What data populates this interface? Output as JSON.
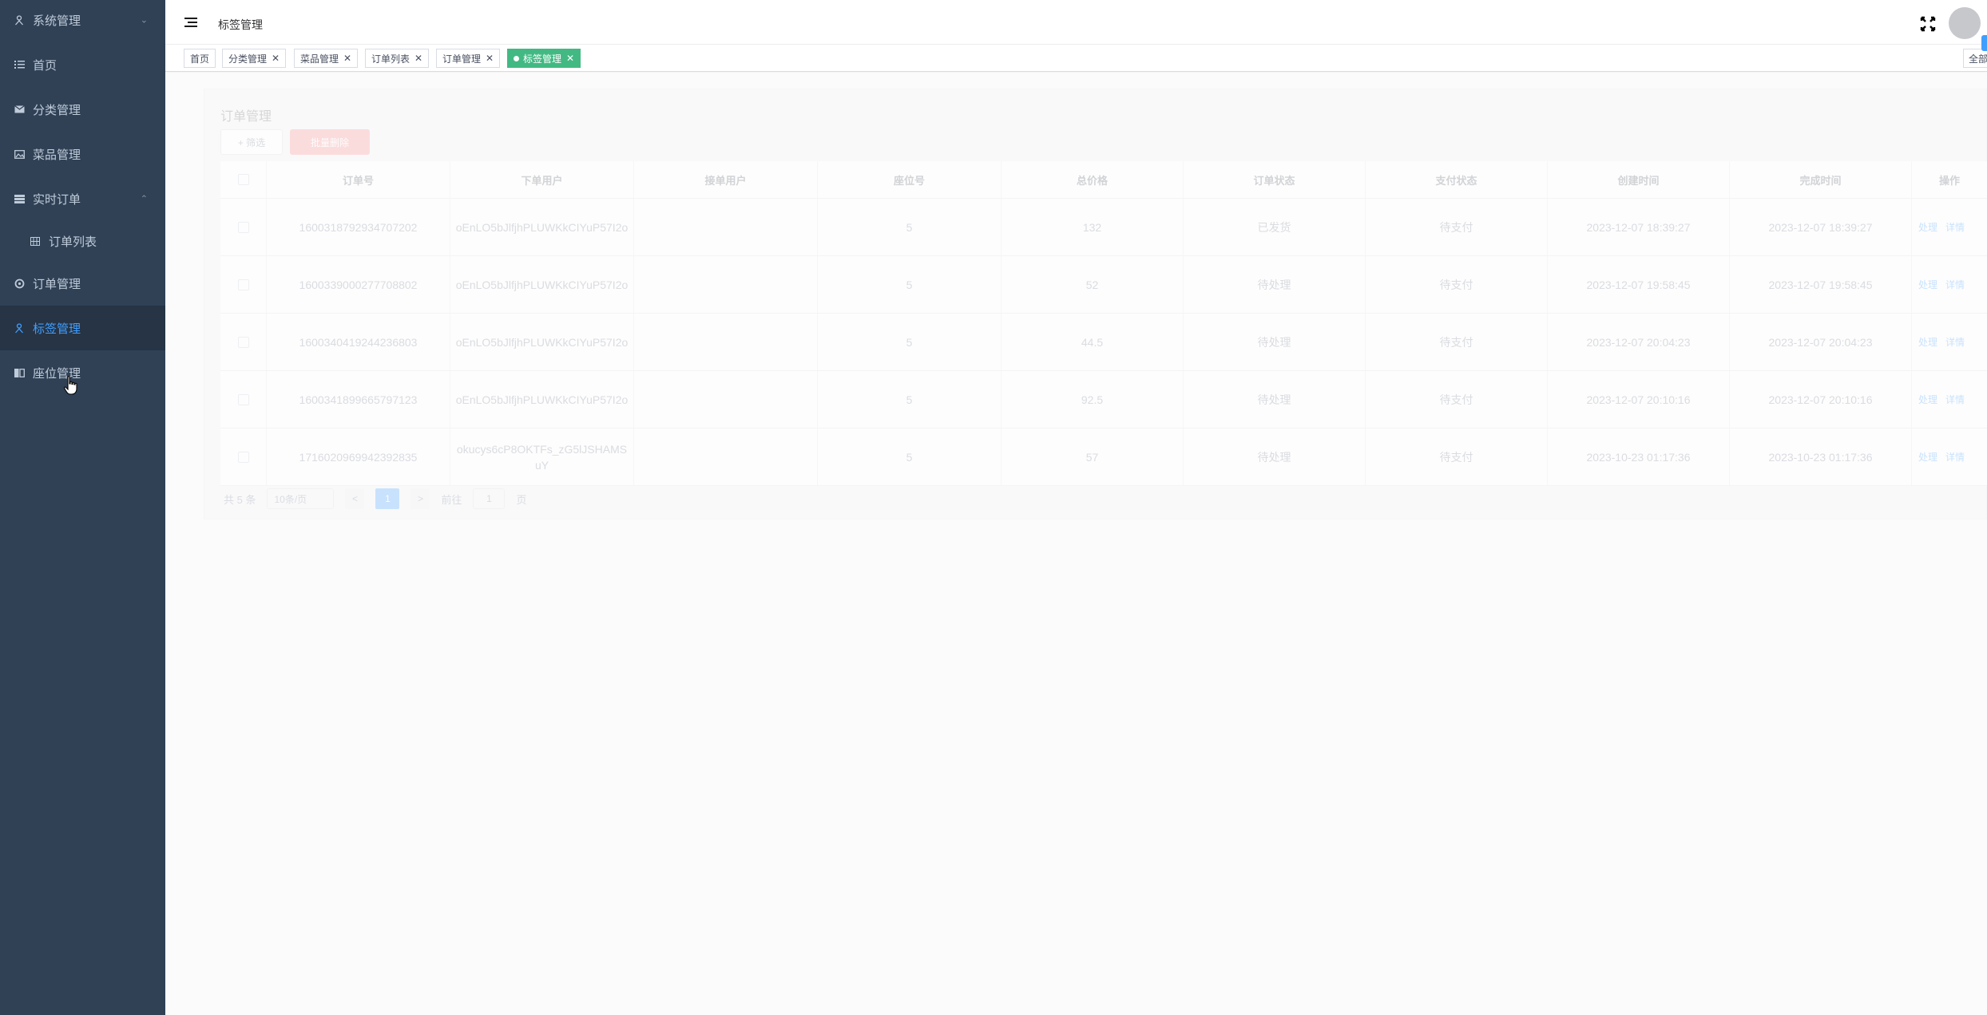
{
  "sidebar": {
    "items": [
      {
        "label": "系统管理",
        "icon": "person-icon",
        "chevron": "⌄"
      },
      {
        "label": "首页",
        "icon": "list-icon"
      },
      {
        "label": "分类管理",
        "icon": "mail-icon"
      },
      {
        "label": "菜品管理",
        "icon": "image-icon"
      },
      {
        "label": "实时订单",
        "icon": "grid-icon",
        "chevron": "⌃"
      },
      {
        "label": "订单列表",
        "icon": "table-icon"
      },
      {
        "label": "订单管理",
        "icon": "refresh-icon"
      },
      {
        "label": "标签管理",
        "icon": "person-icon"
      },
      {
        "label": "座位管理",
        "icon": "book-icon"
      }
    ],
    "active_color": "#409eff"
  },
  "navbar": {
    "breadcrumb": "标签管理"
  },
  "tags": [
    {
      "label": "首页",
      "closable": false
    },
    {
      "label": "分类管理",
      "closable": true
    },
    {
      "label": "菜品管理",
      "closable": true
    },
    {
      "label": "订单列表",
      "closable": true
    },
    {
      "label": "订单管理",
      "closable": true
    },
    {
      "label": "标签管理",
      "closable": true,
      "active": true
    }
  ],
  "tags_all_label": "全部",
  "card": {
    "title": "订单管理",
    "filter_button": "+ 筛选",
    "delete_button": "批量删除"
  },
  "table": {
    "headers": [
      "订单号",
      "下单用户",
      "接单用户",
      "座位号",
      "总价格",
      "订单状态",
      "支付状态",
      "创建时间",
      "完成时间",
      "操作"
    ],
    "rows": [
      {
        "order_no": "1600318792934707202",
        "user": "oEnLO5bJlfjhPLUWKkCIYuP57I2o",
        "receiver": "",
        "seat": "5",
        "price": "132",
        "status": "已发货",
        "pay": "待支付",
        "created": "2023-12-07 18:39:27",
        "finished": "2023-12-07 18:39:27"
      },
      {
        "order_no": "1600339000277708802",
        "user": "oEnLO5bJlfjhPLUWKkCIYuP57I2o",
        "receiver": "",
        "seat": "5",
        "price": "52",
        "status": "待处理",
        "pay": "待支付",
        "created": "2023-12-07 19:58:45",
        "finished": "2023-12-07 19:58:45"
      },
      {
        "order_no": "1600340419244236803",
        "user": "oEnLO5bJlfjhPLUWKkCIYuP57I2o",
        "receiver": "",
        "seat": "5",
        "price": "44.5",
        "status": "待处理",
        "pay": "待支付",
        "created": "2023-12-07 20:04:23",
        "finished": "2023-12-07 20:04:23"
      },
      {
        "order_no": "1600341899665797123",
        "user": "oEnLO5bJlfjhPLUWKkCIYuP57I2o",
        "receiver": "",
        "seat": "5",
        "price": "92.5",
        "status": "待处理",
        "pay": "待支付",
        "created": "2023-12-07 20:10:16",
        "finished": "2023-12-07 20:10:16"
      },
      {
        "order_no": "1716020969942392835",
        "user": "okucys6cP8OKTFs_zG5lJSHAMSuY",
        "receiver": "",
        "seat": "5",
        "price": "57",
        "status": "待处理",
        "pay": "待支付",
        "created": "2023-10-23 01:17:36",
        "finished": "2023-10-23 01:17:36"
      }
    ],
    "op_process": "处理",
    "op_detail": "详情"
  },
  "pager": {
    "total": "共 5 条",
    "size": "10条/页",
    "prev": "<",
    "current": "1",
    "next": ">",
    "goto_label": "前往",
    "goto_value": "1",
    "page_unit": "页"
  }
}
